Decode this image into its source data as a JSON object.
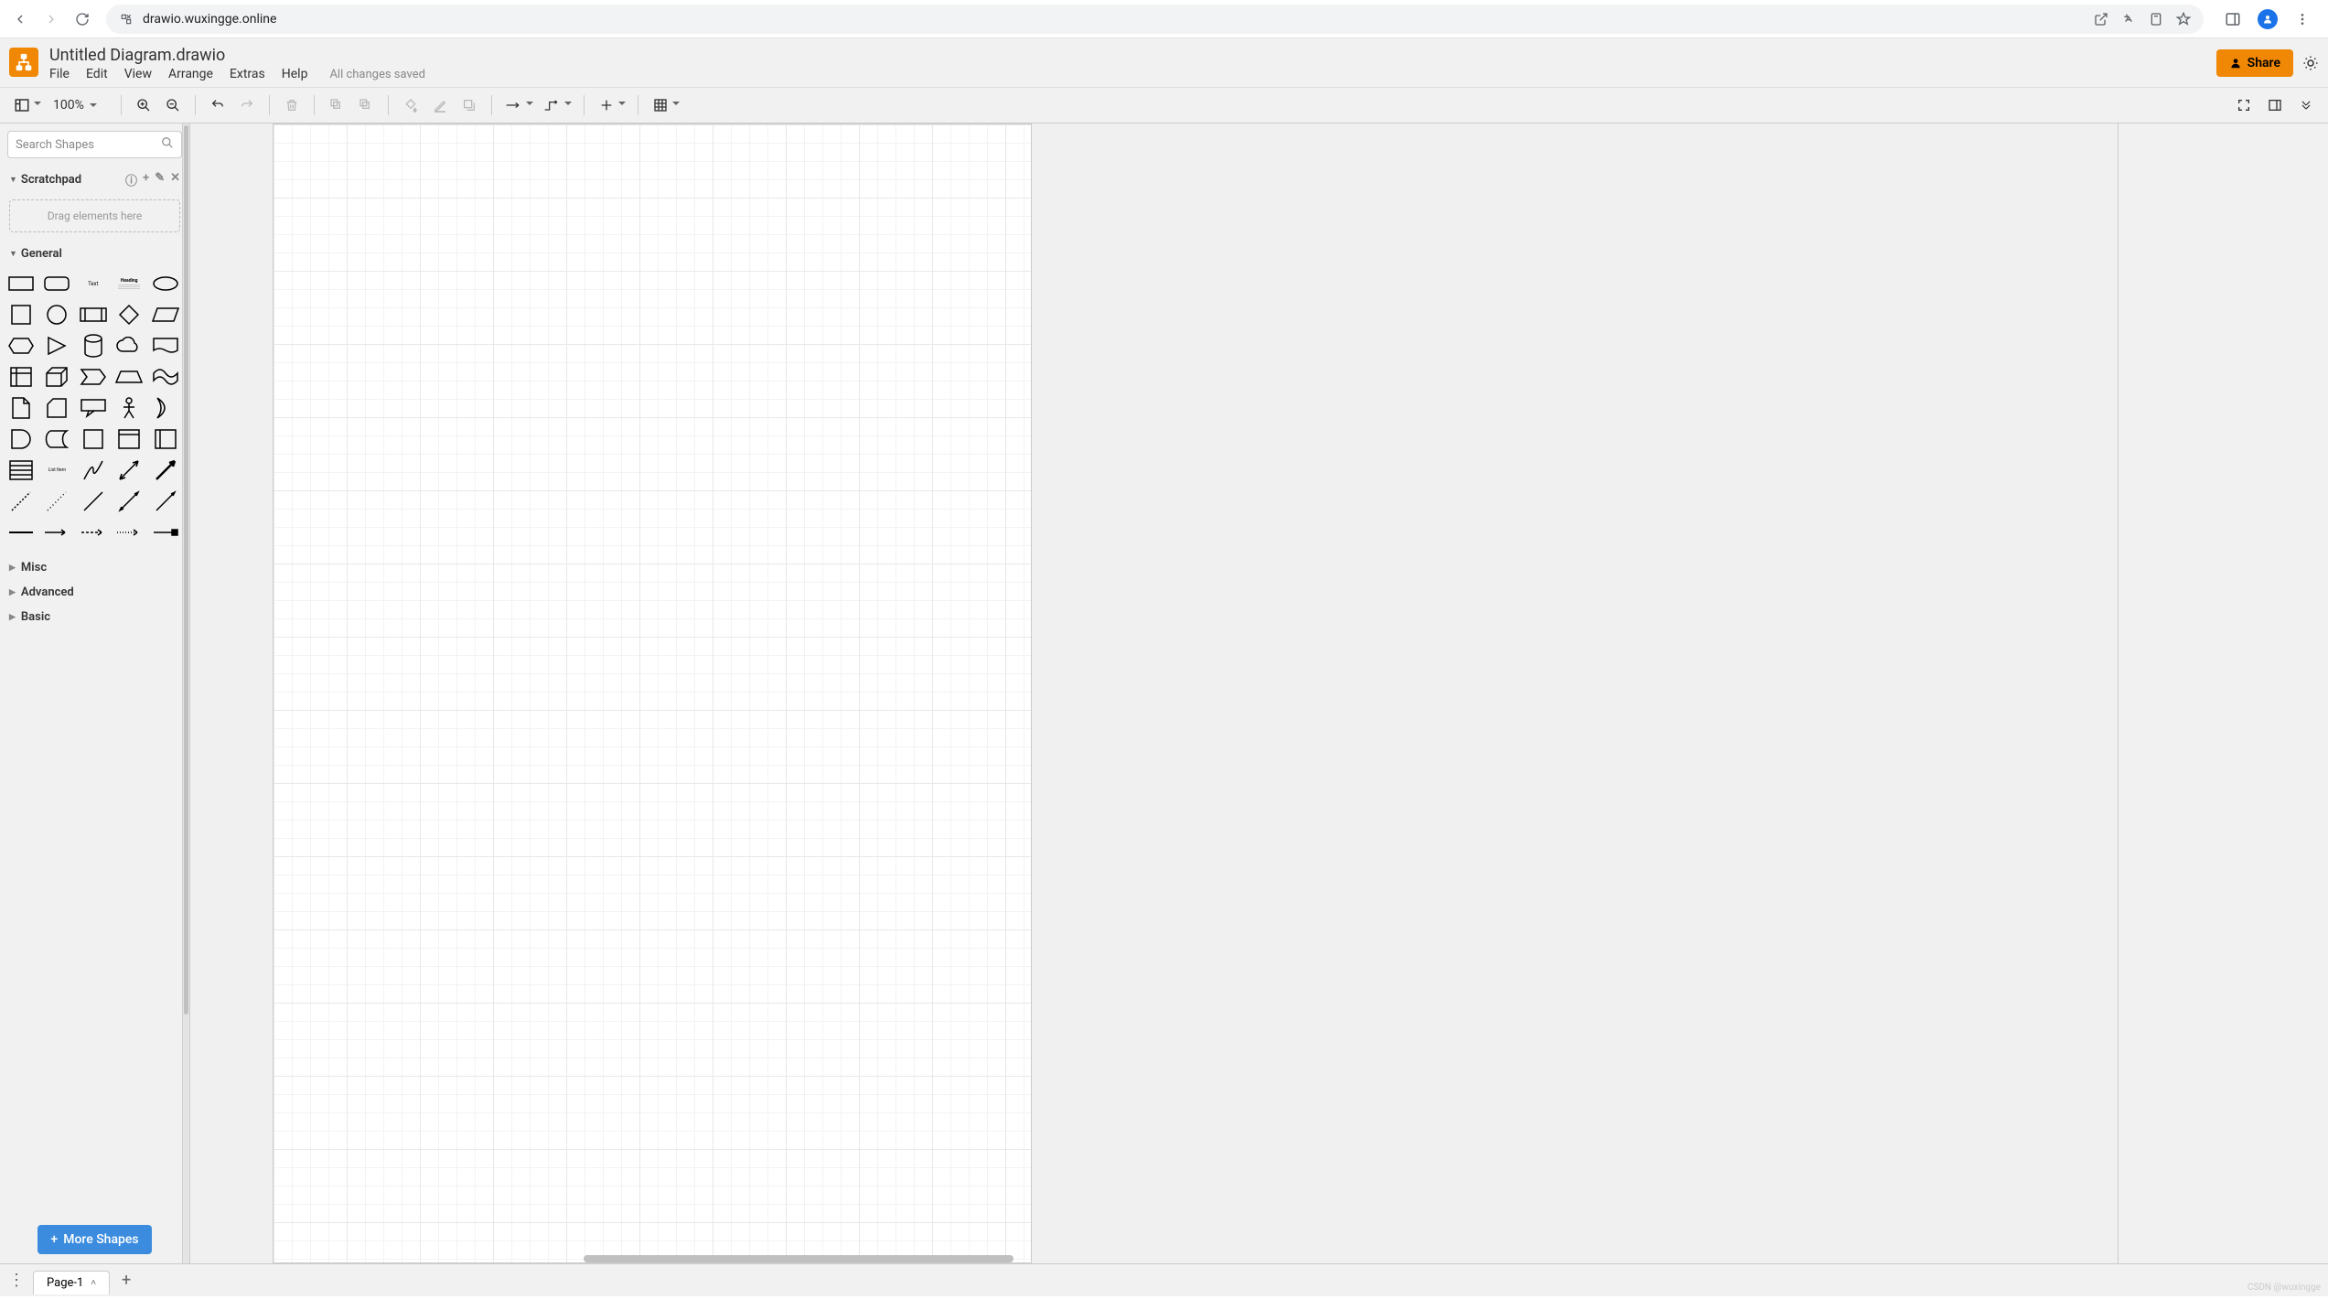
{
  "browser": {
    "url": "drawio.wuxingge.online"
  },
  "header": {
    "doc_title": "Untitled Diagram.drawio",
    "menus": [
      "File",
      "Edit",
      "View",
      "Arrange",
      "Extras",
      "Help"
    ],
    "saved_status": "All changes saved",
    "share_label": "Share"
  },
  "toolbar": {
    "zoom": "100%"
  },
  "sidebar": {
    "search_placeholder": "Search Shapes",
    "scratchpad_label": "Scratchpad",
    "scratchpad_drop": "Drag elements here",
    "categories": {
      "general": "General",
      "misc": "Misc",
      "advanced": "Advanced",
      "basic": "Basic"
    },
    "more_shapes": "More Shapes",
    "shape_text": "Text",
    "shape_heading": "Heading",
    "shape_listitem": "List Item"
  },
  "footer": {
    "page_tab": "Page-1",
    "watermark": "CSDN @wuxingge"
  }
}
